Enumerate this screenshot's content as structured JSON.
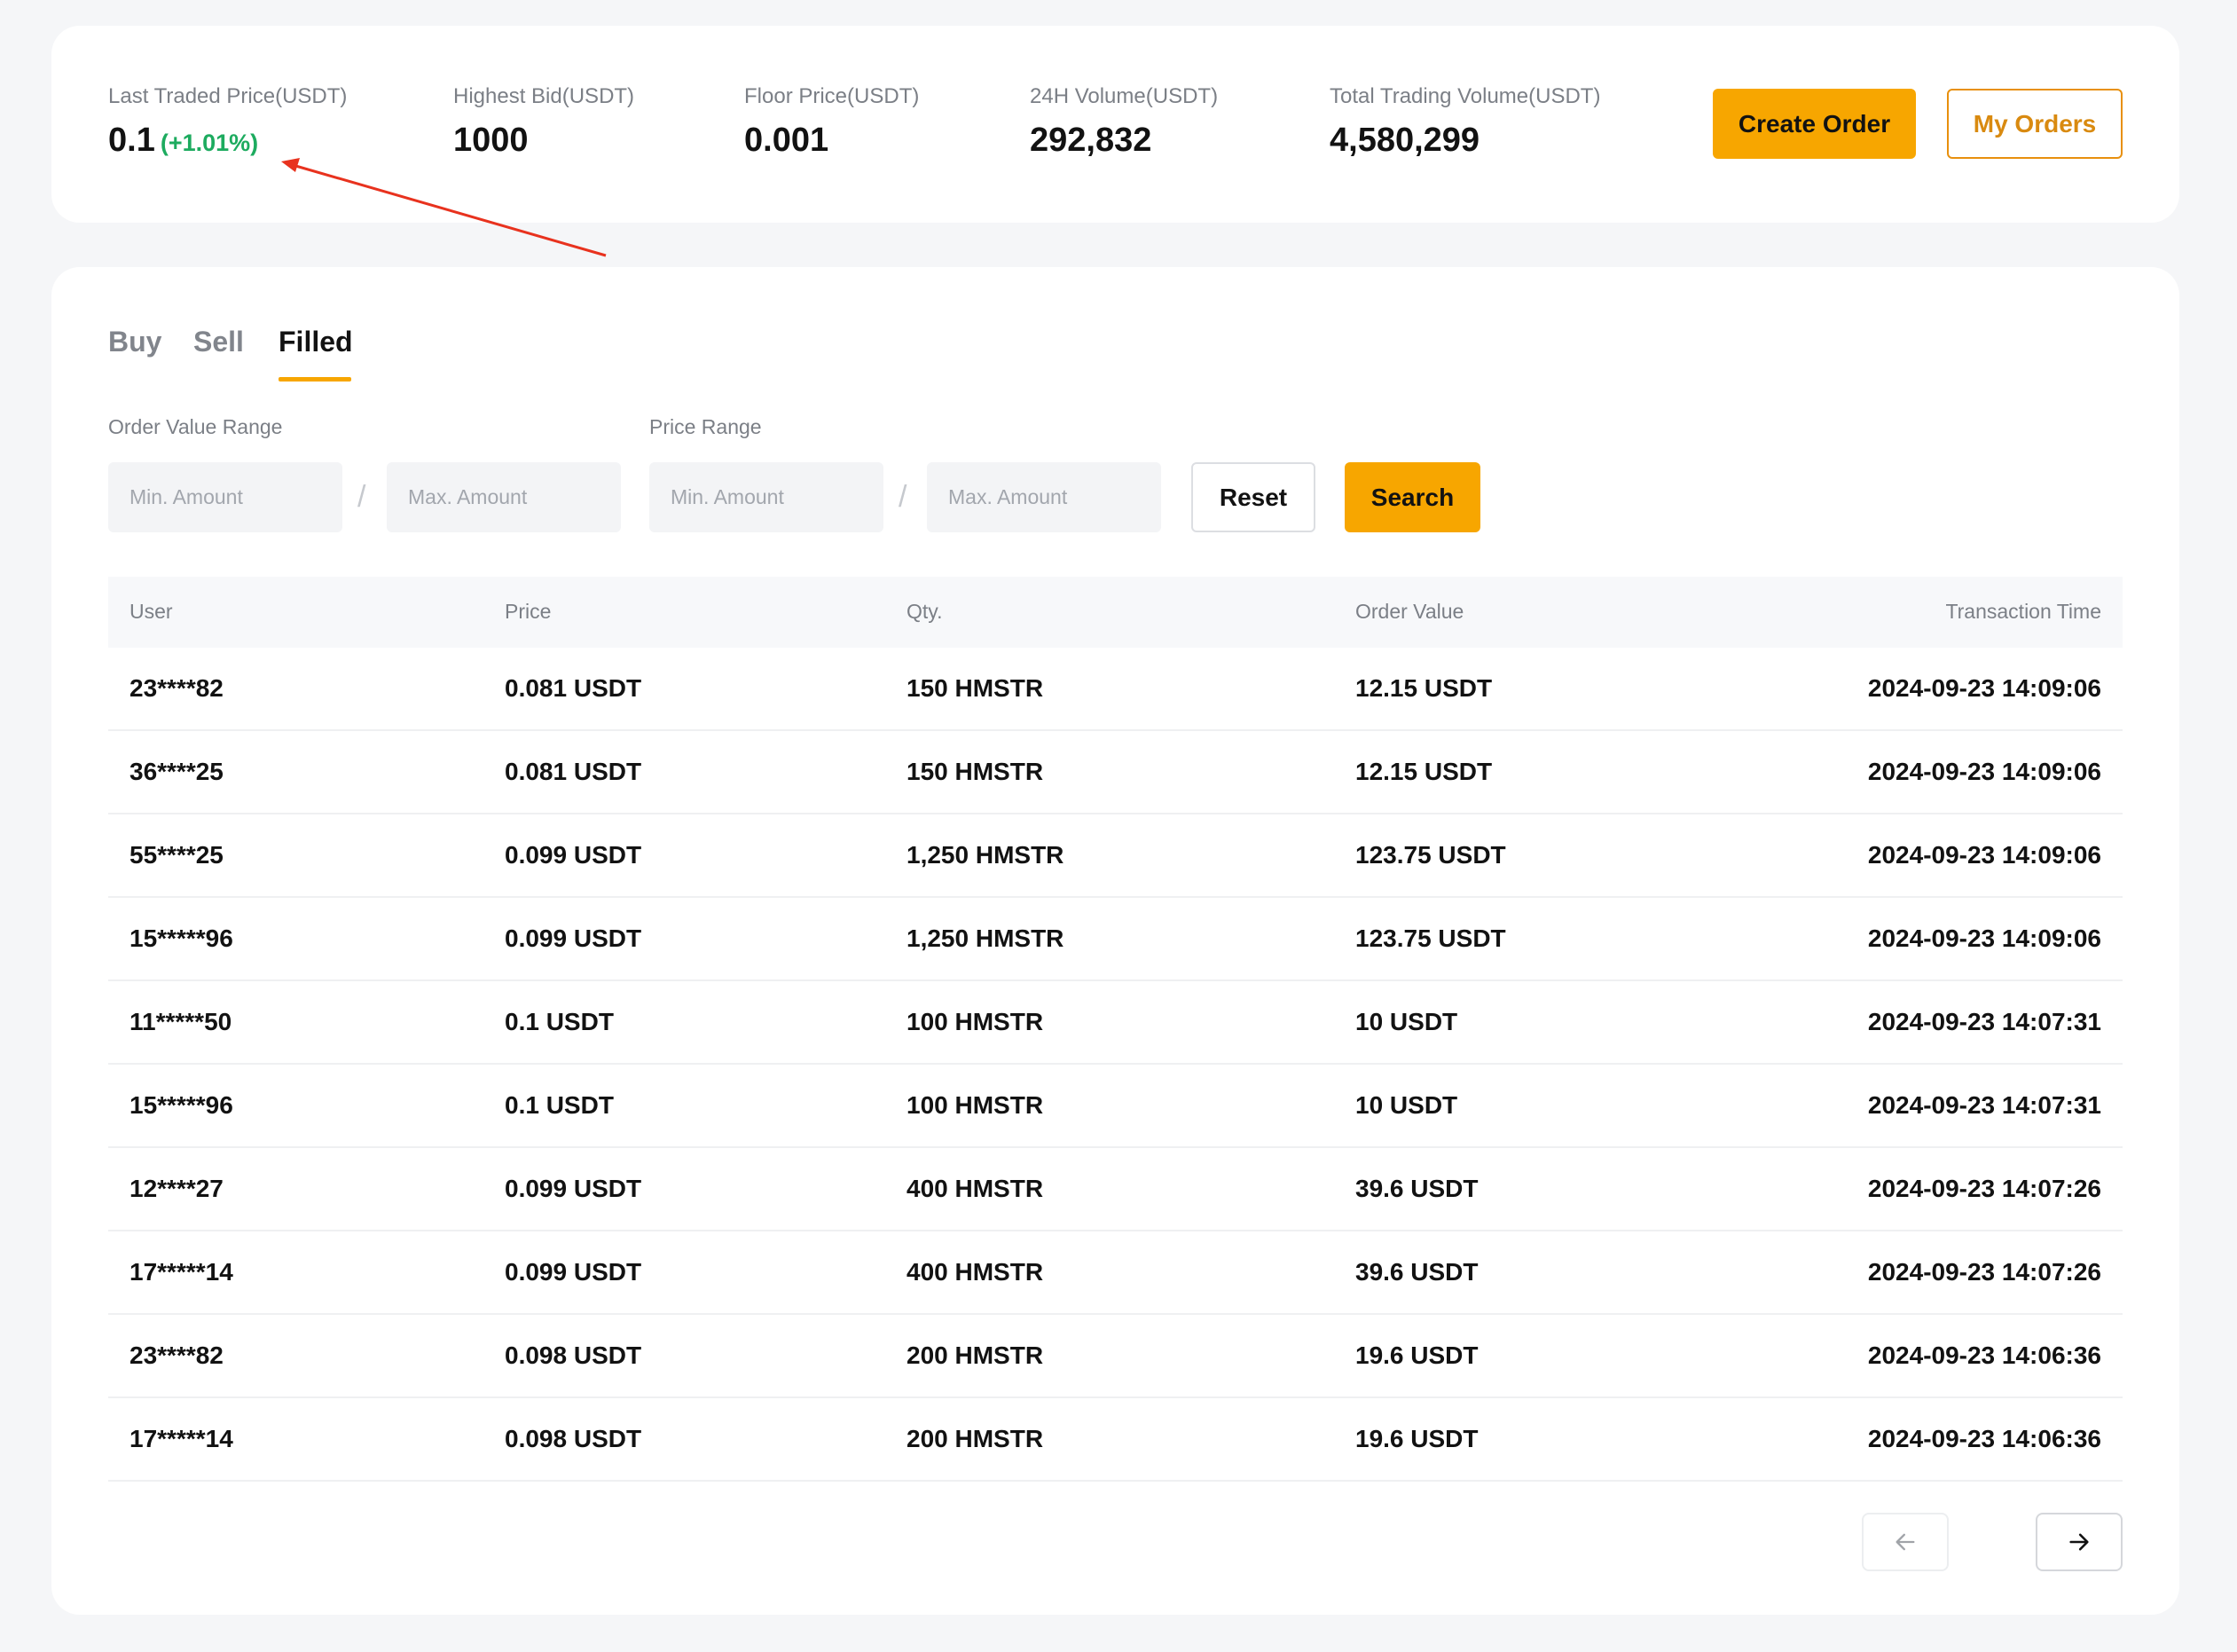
{
  "stats": [
    {
      "label": "Last Traded Price(USDT)",
      "value": "0.1",
      "change": "(+1.01%)"
    },
    {
      "label": "Highest Bid(USDT)",
      "value": "1000"
    },
    {
      "label": "Floor Price(USDT)",
      "value": "0.001"
    },
    {
      "label": "24H Volume(USDT)",
      "value": "292,832"
    },
    {
      "label": "Total Trading Volume(USDT)",
      "value": "4,580,299"
    }
  ],
  "actions": {
    "create_order": "Create Order",
    "my_orders": "My Orders"
  },
  "tabs": [
    {
      "label": "Buy",
      "active": false
    },
    {
      "label": "Sell",
      "active": false
    },
    {
      "label": "Filled",
      "active": true
    }
  ],
  "filters": {
    "order_value_range": {
      "label": "Order Value Range",
      "min_placeholder": "Min. Amount",
      "max_placeholder": "Max. Amount",
      "separator": "/"
    },
    "price_range": {
      "label": "Price Range",
      "min_placeholder": "Min. Amount",
      "max_placeholder": "Max. Amount",
      "separator": "/"
    },
    "reset_label": "Reset",
    "search_label": "Search"
  },
  "table": {
    "columns": [
      "User",
      "Price",
      "Qty.",
      "Order Value",
      "Transaction Time"
    ],
    "rows": [
      {
        "user": "23****82",
        "price": "0.081 USDT",
        "qty": "150 HMSTR",
        "value": "12.15 USDT",
        "time": "2024-09-23 14:09:06"
      },
      {
        "user": "36****25",
        "price": "0.081 USDT",
        "qty": "150 HMSTR",
        "value": "12.15 USDT",
        "time": "2024-09-23 14:09:06"
      },
      {
        "user": "55****25",
        "price": "0.099 USDT",
        "qty": "1,250 HMSTR",
        "value": "123.75 USDT",
        "time": "2024-09-23 14:09:06"
      },
      {
        "user": "15*****96",
        "price": "0.099 USDT",
        "qty": "1,250 HMSTR",
        "value": "123.75 USDT",
        "time": "2024-09-23 14:09:06"
      },
      {
        "user": "11*****50",
        "price": "0.1 USDT",
        "qty": "100 HMSTR",
        "value": "10 USDT",
        "time": "2024-09-23 14:07:31"
      },
      {
        "user": "15*****96",
        "price": "0.1 USDT",
        "qty": "100 HMSTR",
        "value": "10 USDT",
        "time": "2024-09-23 14:07:31"
      },
      {
        "user": "12****27",
        "price": "0.099 USDT",
        "qty": "400 HMSTR",
        "value": "39.6 USDT",
        "time": "2024-09-23 14:07:26"
      },
      {
        "user": "17*****14",
        "price": "0.099 USDT",
        "qty": "400 HMSTR",
        "value": "39.6 USDT",
        "time": "2024-09-23 14:07:26"
      },
      {
        "user": "23****82",
        "price": "0.098 USDT",
        "qty": "200 HMSTR",
        "value": "19.6 USDT",
        "time": "2024-09-23 14:06:36"
      },
      {
        "user": "17*****14",
        "price": "0.098 USDT",
        "qty": "200 HMSTR",
        "value": "19.6 USDT",
        "time": "2024-09-23 14:06:36"
      }
    ]
  },
  "pagination": {
    "prev_icon": "arrow-left-icon",
    "next_icon": "arrow-right-icon",
    "prev_disabled": true
  },
  "colors": {
    "accent": "#f7a600",
    "positive": "#1dab5f",
    "annotation": "#e8321e"
  }
}
